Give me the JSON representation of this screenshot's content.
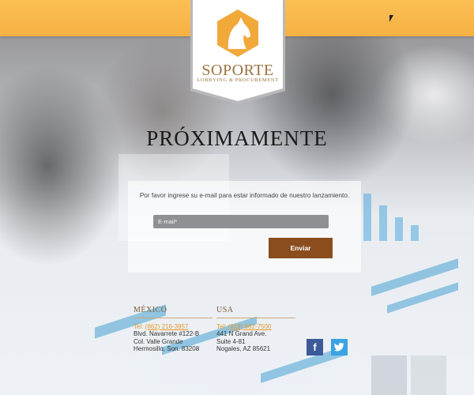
{
  "brand": {
    "name": "SOPORTE",
    "tagline": "LOBBYING & PROCUREMENT",
    "icon": "horse-head-icon",
    "accent_color": "#f6b143",
    "brand_brown": "#8b4d1e"
  },
  "headline": "PRÓXIMAMENTE",
  "signup": {
    "prompt": "Por favor ingrese su e-mail para estar informado de nuestro lanzamiento.",
    "email_placeholder": "E-mail*",
    "submit_label": "Enviar"
  },
  "offices": [
    {
      "country": "MÉXICO",
      "tel_prefix": "Tel: ",
      "tel": "(662) 216-3957",
      "address": [
        "Blvd. Navarrete #122-B",
        "Col. Valle Grande",
        "Hermosillo, Son. 83208"
      ]
    },
    {
      "country": "USA",
      "tel_prefix": "Tel: ",
      "tel": "(619) 862-7500",
      "address": [
        "441 N Grand Ave.",
        "Suite 4-81",
        "Nogales, AZ 85621"
      ]
    }
  ],
  "social": {
    "facebook_label": "f",
    "facebook_icon": "facebook-icon",
    "twitter_icon": "twitter-icon"
  }
}
